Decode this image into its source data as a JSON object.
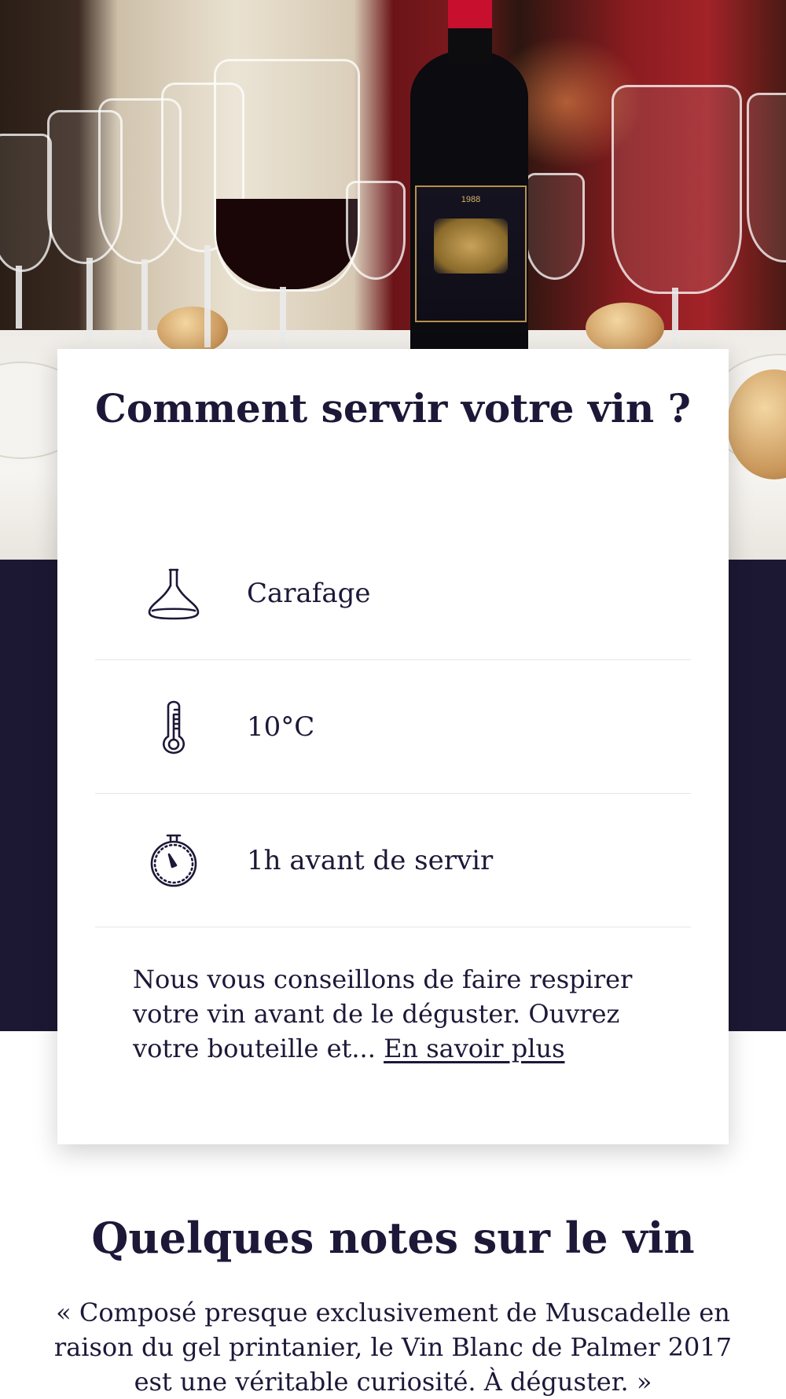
{
  "colors": {
    "navy": "#1c1834",
    "text": "#1d1838",
    "card_bg": "#ffffff",
    "divider": "#e6e4ea"
  },
  "serving": {
    "title": "Comment servir votre vin ?",
    "items": [
      {
        "icon": "decanter-icon",
        "label": "Carafage"
      },
      {
        "icon": "thermometer-icon",
        "label": "10°C"
      },
      {
        "icon": "stopwatch-icon",
        "label": "1h avant de servir"
      }
    ],
    "advice_text": "Nous vous conseillons de faire respirer votre vin avant de le déguster. Ouvrez votre bouteille et... ",
    "advice_link": "En savoir plus"
  },
  "notes": {
    "title": "Quelques notes sur le vin",
    "quote": "« Composé presque exclusivement de Muscadelle en raison du gel printanier, le Vin Blanc de Palmer 2017 est une véritable curiosité. À déguster. »"
  }
}
